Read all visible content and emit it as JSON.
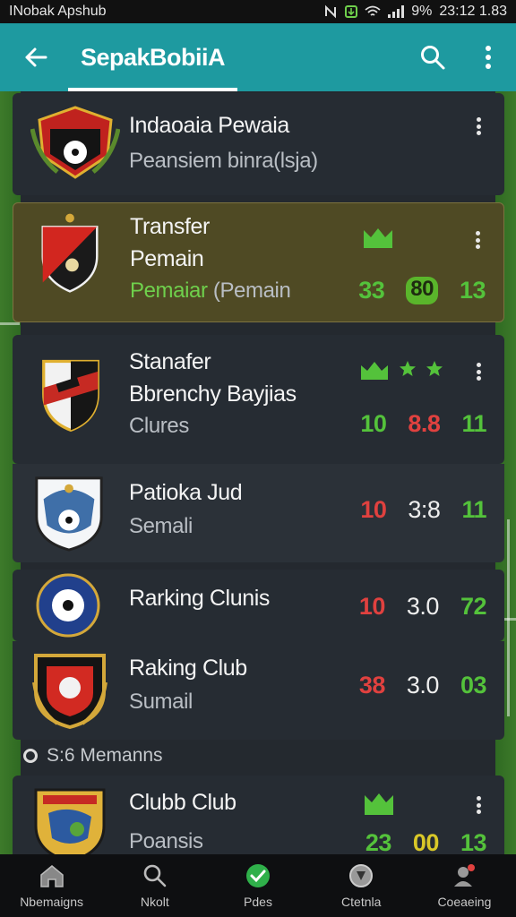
{
  "status_bar": {
    "left_text": "INobak Apshub",
    "battery": "9%",
    "time": "23:12 1.83"
  },
  "app_bar": {
    "title": "SepakBobiiA"
  },
  "list": [
    {
      "title": "Indaoaia Pewaia",
      "subtitle": "Peansiem binra(lsja)"
    },
    {
      "title_line1": "Transfer",
      "title_line2": "Pemain",
      "subtitle_green": "Pemaiar",
      "subtitle_rest": " (Pemain",
      "stats": [
        "33",
        "80",
        "13"
      ]
    },
    {
      "title_line1": "Stanafer",
      "title_line2": "Bbrenchy Bayjias",
      "subtitle": "Clures",
      "stats": [
        "10",
        "8.8",
        "11"
      ]
    },
    {
      "title": "Patioka Jud",
      "subtitle": "Semali",
      "stats": [
        "10",
        "3:8",
        "11"
      ]
    },
    {
      "title": "Rarking Clunis",
      "stats": [
        "10",
        "3.0",
        "72"
      ]
    },
    {
      "title": "Raking Club",
      "subtitle": "Sumail",
      "stats": [
        "38",
        "3.0",
        "03"
      ]
    },
    {
      "title": "Clubb Club",
      "subtitle": "Poansis",
      "stats": [
        "23",
        "00",
        "13"
      ]
    }
  ],
  "section_label": "S:6 Memanns",
  "bottom_nav": [
    {
      "label": "Nbemaigns",
      "icon": "home-icon"
    },
    {
      "label": "Nkolt",
      "icon": "search-icon"
    },
    {
      "label": "Pdes",
      "icon": "check-icon"
    },
    {
      "label": "Ctetnla",
      "icon": "ball-icon"
    },
    {
      "label": "Coeaeing",
      "icon": "profile-icon"
    }
  ],
  "colors": {
    "app_bar": "#1e9aa0",
    "highlight_card": "#4f4a24",
    "accent_green": "#54c23b",
    "accent_red": "#e0413f"
  }
}
